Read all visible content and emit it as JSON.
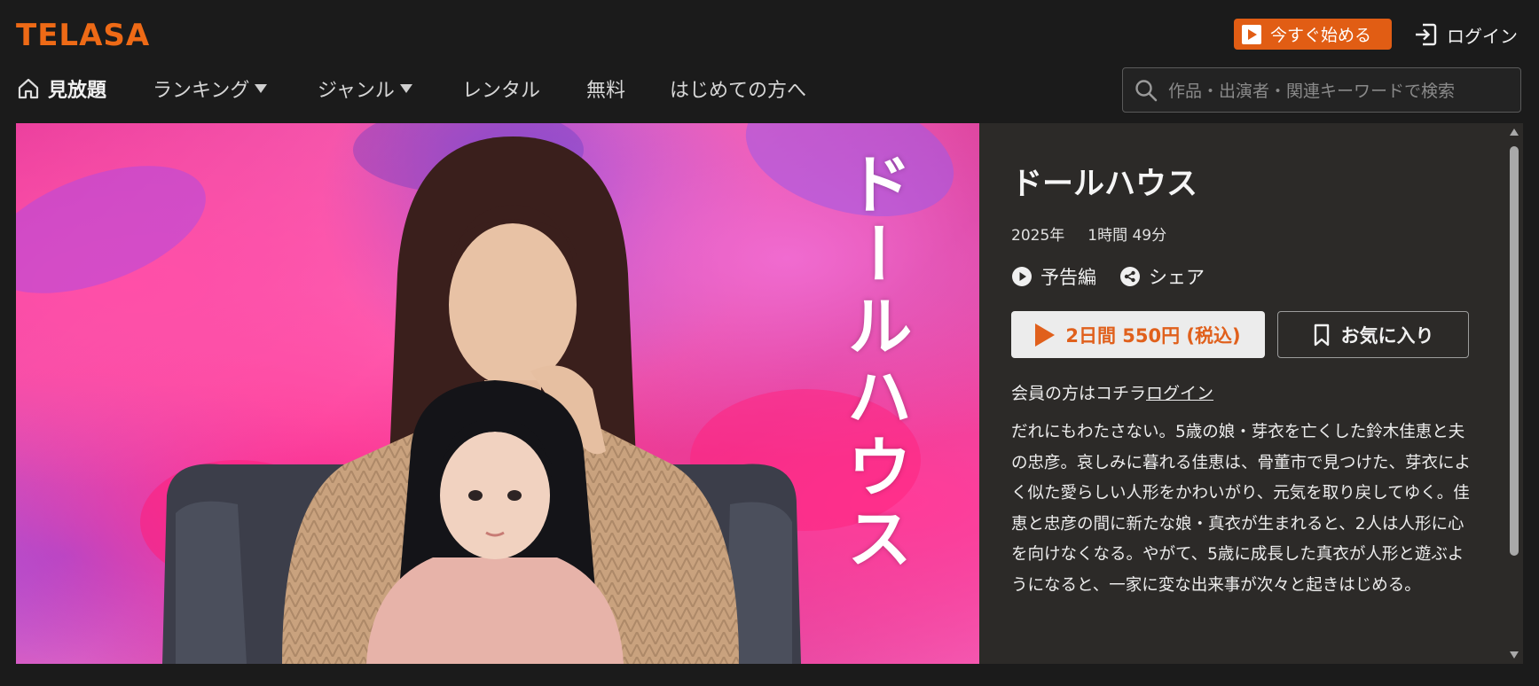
{
  "header": {
    "logo": "TELASA",
    "start_label": "今すぐ始める",
    "login_label": "ログイン"
  },
  "nav": {
    "items": [
      {
        "label": "見放題",
        "icon": "home-icon"
      },
      {
        "label": "ランキング",
        "dropdown": true
      },
      {
        "label": "ジャンル",
        "dropdown": true
      },
      {
        "label": "レンタル"
      },
      {
        "label": "無料"
      },
      {
        "label": "はじめての方へ"
      }
    ]
  },
  "search": {
    "placeholder": "作品・出演者・関連キーワードで検索"
  },
  "hero": {
    "title_art": "ドールハウス"
  },
  "detail": {
    "title": "ドールハウス",
    "year": "2025年",
    "duration": "1時間 49分",
    "trailer_label": "予告編",
    "share_label": "シェア",
    "rent_label": "2日間 550円 (税込)",
    "favorite_label": "お気に入り",
    "member_text": "会員の方はコチラ",
    "member_link": "ログイン",
    "description": "だれにもわたさない。5歳の娘・芽衣を亡くした鈴木佳恵と夫の忠彦。哀しみに暮れる佳恵は、骨董市で見つけた、芽衣によく似た愛らしい人形をかわいがり、元気を取り戻してゆく。佳恵と忠彦の間に新たな娘・真衣が生まれると、2人は人形に心を向けなくなる。やがて、5歳に成長した真衣が人形と遊ぶようになると、一家に変な出来事が次々と起きはじめる。"
  },
  "colors": {
    "accent": "#e15d14",
    "background": "#1b1b1b",
    "panel": "#2c2a28"
  }
}
